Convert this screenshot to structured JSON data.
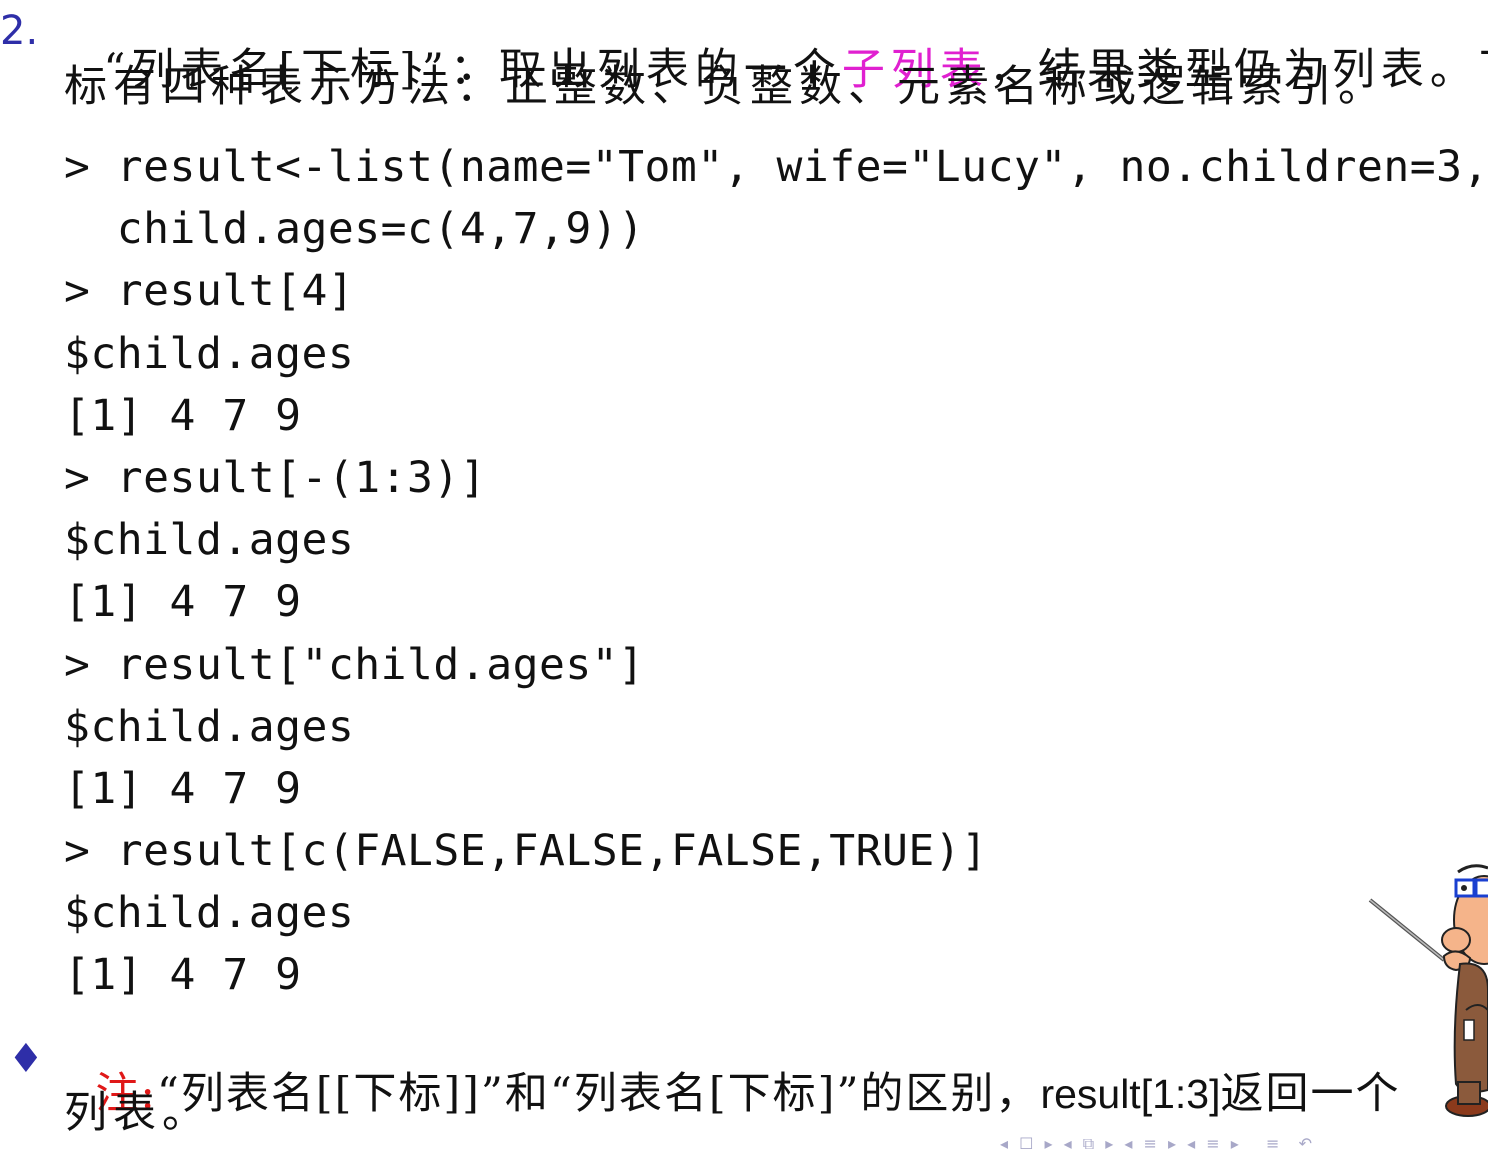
{
  "item": {
    "number": "2.",
    "line1_quote": "“列表名[下标]”：取出列表的一个",
    "line1_highlight": "子列表",
    "line1_rest": "，结果类型仍为列表。下",
    "line2": "标有四种表示方法：正整数、负整数、元素名称或逻辑索引。"
  },
  "code_lines": [
    "> result<-list(name=\"Tom\", wife=\"Lucy\", no.children=3,",
    "  child.ages=c(4,7,9))",
    "> result[4]",
    "$child.ages",
    "[1] 4 7 9",
    "> result[-(1:3)]",
    "$child.ages",
    "[1] 4 7 9",
    "> result[\"child.ages\"]",
    "$child.ages",
    "[1] 4 7 9",
    "> result[c(FALSE,FALSE,FALSE,TRUE)]",
    "$child.ages",
    "[1] 4 7 9"
  ],
  "note": {
    "bullet": "♦",
    "label": "注:",
    "text_a": "“列表名[[下标]]”和“列表名[下标]”的区别，",
    "text_code": "result[1:3]",
    "text_b": "返回一个",
    "line2": "列表。"
  },
  "nav_bar": {
    "symbols": "◂ ☐ ▸ ◂ ⧉ ▸ ◂ ≡ ▸ ◂ ≡ ▸   ≡  ↶"
  },
  "colors": {
    "accent_blue": "#2e2ea8",
    "highlight_magenta": "#e020d0",
    "note_red": "#e01818"
  }
}
